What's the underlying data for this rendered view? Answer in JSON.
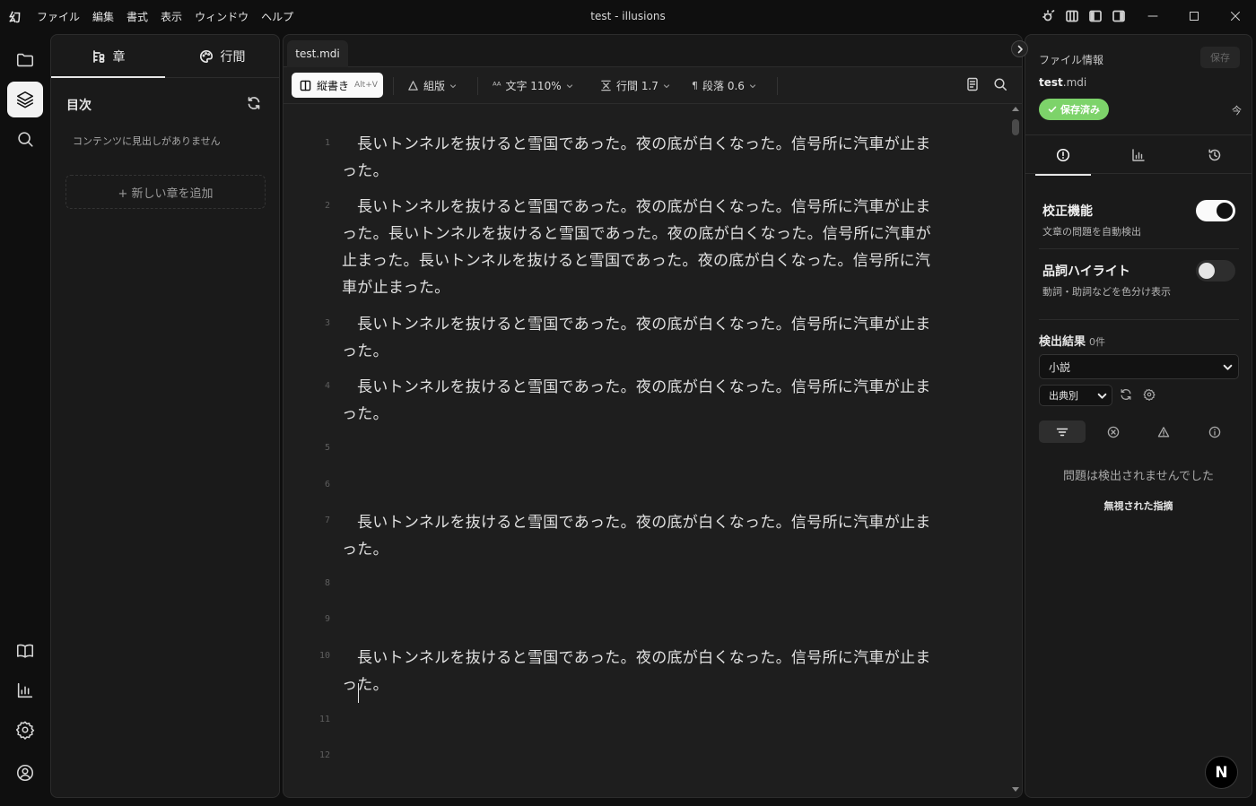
{
  "app": {
    "logo": "幻",
    "title": "test - illusions"
  },
  "menu": [
    "ファイル",
    "編集",
    "書式",
    "表示",
    "ウィンドウ",
    "ヘルプ"
  ],
  "title_icons": [
    "sun-bug-icon",
    "layout-panel-left-icon",
    "layout-sidebar-left-icon",
    "layout-sidebar-right-icon"
  ],
  "activity_bar": {
    "top": [
      "folder-icon",
      "layers-icon",
      "search-icon"
    ],
    "bottom": [
      "book-icon",
      "bar-chart-icon",
      "gear-icon",
      "user-circle-icon"
    ],
    "active": "layers-icon"
  },
  "left_panel": {
    "tabs": [
      {
        "label": "章",
        "icon": "chapter-tree-icon"
      },
      {
        "label": "行間",
        "icon": "palette-icon"
      }
    ],
    "toc_title": "目次",
    "empty_message": "コンテンツに見出しがありません",
    "add_chapter": "+ 新しい章を追加"
  },
  "editor": {
    "file_tab": "test.mdi",
    "toolbar": {
      "vertical_label": "縦書き",
      "vertical_shortcut": "Alt+V",
      "typeset_label": "組版",
      "font_icon_text": "ᴬᴬ",
      "font_label": "文字 110%",
      "line_label": "行間 1.7",
      "para_icon_text": "¶",
      "para_label": "段落 0.6"
    },
    "lines": [
      {
        "num": "1",
        "text": "長いトンネルを抜けると雪国であった。夜の底が白くなった。信号所に汽車が止まった。"
      },
      {
        "num": "2",
        "text": "長いトンネルを抜けると雪国であった。夜の底が白くなった。信号所に汽車が止まった。長いトンネルを抜けると雪国であった。夜の底が白くなった。信号所に汽車が止まった。長いトンネルを抜けると雪国であった。夜の底が白くなった。信号所に汽車が止まった。"
      },
      {
        "num": "3",
        "text": "長いトンネルを抜けると雪国であった。夜の底が白くなった。信号所に汽車が止まった。"
      },
      {
        "num": "4",
        "text": "長いトンネルを抜けると雪国であった。夜の底が白くなった。信号所に汽車が止まった。"
      },
      {
        "num": "5",
        "text": ""
      },
      {
        "num": "6",
        "text": ""
      },
      {
        "num": "7",
        "text": "長いトンネルを抜けると雪国であった。夜の底が白くなった。信号所に汽車が止まった。"
      },
      {
        "num": "8",
        "text": ""
      },
      {
        "num": "9",
        "text": ""
      },
      {
        "num": "10",
        "text": "長いトンネルを抜けると雪国であった。夜の底が白くなった。信号所に汽車が止まった。"
      },
      {
        "num": "11",
        "text": ""
      },
      {
        "num": "12",
        "text": ""
      }
    ]
  },
  "right_panel": {
    "file_info_label": "ファイル情報",
    "save_label": "保存",
    "filename_base": "test",
    "filename_ext": ".mdi",
    "saved_badge": "保存済み",
    "saved_time": "今",
    "tabs": [
      "alert-circle-icon",
      "bar-chart-icon",
      "history-icon"
    ],
    "proofread": {
      "title": "校正機能",
      "desc": "文章の問題を自動検出",
      "on": true
    },
    "pos_highlight": {
      "title": "品詞ハイライト",
      "desc": "動詞・助詞などを色分け表示",
      "on": false
    },
    "results_label": "検出結果",
    "results_count": "0件",
    "genre_value": "小説",
    "source_value": "出典別",
    "filters": [
      "filter-icon",
      "x-circle-icon",
      "warning-triangle-icon",
      "info-icon"
    ],
    "no_issues": "問題は検出されませんでした",
    "ignored_link": "無視された指摘"
  },
  "badge": "N",
  "colors": {
    "saved_badge": "#7dd36a",
    "background": "#0f0f0f",
    "editor_bg": "#1e1e1e",
    "panel_bg": "#1a1a1a"
  }
}
